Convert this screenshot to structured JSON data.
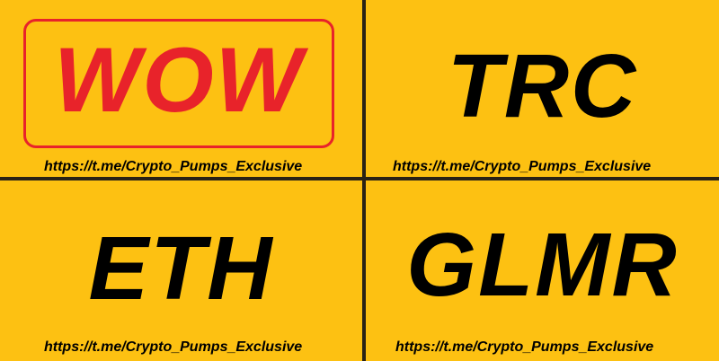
{
  "colors": {
    "background": "#FDC112",
    "divider": "#2a2215",
    "accent_red": "#E8232A",
    "text": "#000000"
  },
  "tiles": [
    {
      "ticker": "WOW",
      "link": "https://t.me/Crypto_Pumps_Exclusive"
    },
    {
      "ticker": "TRC",
      "link": "https://t.me/Crypto_Pumps_Exclusive"
    },
    {
      "ticker": "ETH",
      "link": "https://t.me/Crypto_Pumps_Exclusive"
    },
    {
      "ticker": "GLMR",
      "link": "https://t.me/Crypto_Pumps_Exclusive"
    }
  ]
}
